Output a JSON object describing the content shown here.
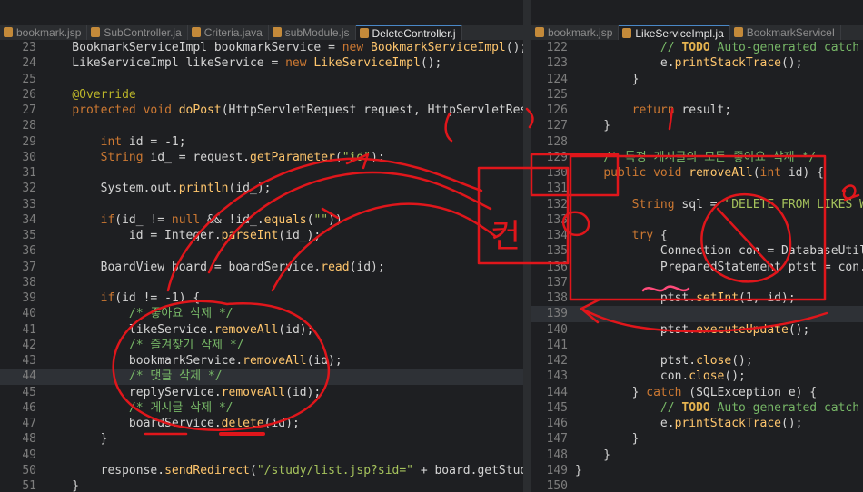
{
  "left_tabs": [
    "bookmark.jsp",
    "SubController.ja",
    "Criteria.java",
    "subModule.js",
    "DeleteController.j"
  ],
  "right_tabs": [
    "bookmark.jsp",
    "LikeServiceImpl.ja",
    "BookmarkServiceI"
  ],
  "left_lines": [
    {
      "n": "23",
      "t": "    BookmarkServiceImpl bookmarkService = new BookmarkServiceImpl();"
    },
    {
      "n": "24",
      "t": "    LikeServiceImpl likeService = new LikeServiceImpl();"
    },
    {
      "n": "25",
      "t": ""
    },
    {
      "n": "26",
      "t": "    @Override"
    },
    {
      "n": "27",
      "t": "    protected void doPost(HttpServletRequest request, HttpServletResp"
    },
    {
      "n": "28",
      "t": ""
    },
    {
      "n": "29",
      "t": "        int id = -1;"
    },
    {
      "n": "30",
      "t": "        String id_ = request.getParameter(\"id\");"
    },
    {
      "n": "31",
      "t": ""
    },
    {
      "n": "32",
      "t": "        System.out.println(id_);"
    },
    {
      "n": "33",
      "t": ""
    },
    {
      "n": "34",
      "t": "        if(id_ != null && !id_.equals(\"\"))"
    },
    {
      "n": "35",
      "t": "            id = Integer.parseInt(id_);"
    },
    {
      "n": "36",
      "t": ""
    },
    {
      "n": "37",
      "t": "        BoardView board = boardService.read(id);"
    },
    {
      "n": "38",
      "t": ""
    },
    {
      "n": "39",
      "t": "        if(id != -1) {"
    },
    {
      "n": "40",
      "t": "            /* 좋아요 삭제 */"
    },
    {
      "n": "41",
      "t": "            likeService.removeAll(id);"
    },
    {
      "n": "42",
      "t": "            /* 즐겨찾기 삭제 */"
    },
    {
      "n": "43",
      "t": "            bookmarkService.removeAll(id);"
    },
    {
      "n": "44",
      "t": "            /* 댓글 삭제 */"
    },
    {
      "n": "45",
      "t": "            replyService.removeAll(id);"
    },
    {
      "n": "46",
      "t": "            /* 게시글 삭제 */"
    },
    {
      "n": "47",
      "t": "            boardService.delete(id);"
    },
    {
      "n": "48",
      "t": "        }"
    },
    {
      "n": "49",
      "t": ""
    },
    {
      "n": "50",
      "t": "        response.sendRedirect(\"/study/list.jsp?sid=\" + board.getStud"
    },
    {
      "n": "51",
      "t": "    }"
    }
  ],
  "right_lines": [
    {
      "n": "122",
      "t": "            // TODO Auto-generated catch"
    },
    {
      "n": "123",
      "t": "            e.printStackTrace();"
    },
    {
      "n": "124",
      "t": "        }"
    },
    {
      "n": "125",
      "t": ""
    },
    {
      "n": "126",
      "t": "        return result;"
    },
    {
      "n": "127",
      "t": "    }"
    },
    {
      "n": "128",
      "t": ""
    },
    {
      "n": "129",
      "t": "    /* 특정 게시글의 모든 좋아요 삭제 */"
    },
    {
      "n": "130",
      "t": "    public void removeAll(int id) {"
    },
    {
      "n": "131",
      "t": ""
    },
    {
      "n": "132",
      "t": "        String sql = \"DELETE FROM LIKES W"
    },
    {
      "n": "133",
      "t": ""
    },
    {
      "n": "134",
      "t": "        try {"
    },
    {
      "n": "135",
      "t": "            Connection con = DatabaseUtil"
    },
    {
      "n": "136",
      "t": "            PreparedStatement ptst = con."
    },
    {
      "n": "137",
      "t": ""
    },
    {
      "n": "138",
      "t": "            ptst.setInt(1, id);"
    },
    {
      "n": "139",
      "t": ""
    },
    {
      "n": "140",
      "t": "            ptst.executeUpdate();"
    },
    {
      "n": "141",
      "t": ""
    },
    {
      "n": "142",
      "t": "            ptst.close();"
    },
    {
      "n": "143",
      "t": "            con.close();"
    },
    {
      "n": "144",
      "t": "        } catch (SQLException e) {"
    },
    {
      "n": "145",
      "t": "            // TODO Auto-generated catch"
    },
    {
      "n": "146",
      "t": "            e.printStackTrace();"
    },
    {
      "n": "147",
      "t": "        }"
    },
    {
      "n": "148",
      "t": "    }"
    },
    {
      "n": "149",
      "t": "}"
    },
    {
      "n": "150",
      "t": ""
    }
  ],
  "annotations": {
    "circled_word": "컨",
    "stroke_color": "#e0161b"
  },
  "colors": {
    "background": "#1e1f22",
    "keyword": "#cc7832",
    "comment": "#77b767",
    "string": "#a5c25c"
  }
}
